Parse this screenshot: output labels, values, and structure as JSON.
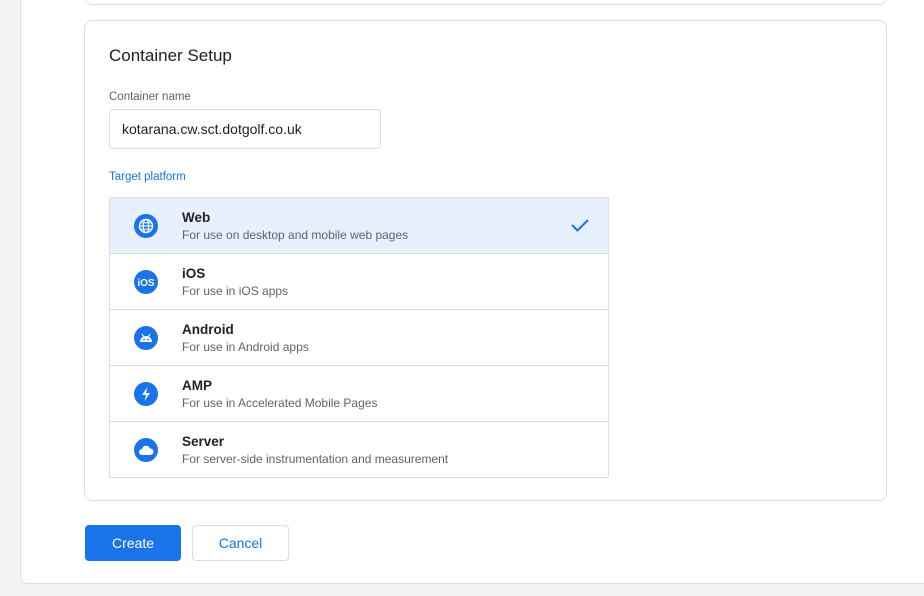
{
  "setup": {
    "title": "Container Setup",
    "name_label": "Container name",
    "name_value": "kotarana.cw.sct.dotgolf.co.uk",
    "platform_label": "Target platform"
  },
  "platforms": [
    {
      "name": "Web",
      "desc": "For use on desktop and mobile web pages",
      "icon": "globe-icon",
      "selected": true
    },
    {
      "name": "iOS",
      "desc": "For use in iOS apps",
      "icon": "ios-icon",
      "selected": false
    },
    {
      "name": "Android",
      "desc": "For use in Android apps",
      "icon": "android-icon",
      "selected": false
    },
    {
      "name": "AMP",
      "desc": "For use in Accelerated Mobile Pages",
      "icon": "amp-bolt-icon",
      "selected": false
    },
    {
      "name": "Server",
      "desc": "For server-side instrumentation and measurement",
      "icon": "cloud-icon",
      "selected": false
    }
  ],
  "actions": {
    "create_label": "Create",
    "cancel_label": "Cancel"
  },
  "colors": {
    "accent": "#1a73e8",
    "selected_bg": "#e8f0fe"
  }
}
